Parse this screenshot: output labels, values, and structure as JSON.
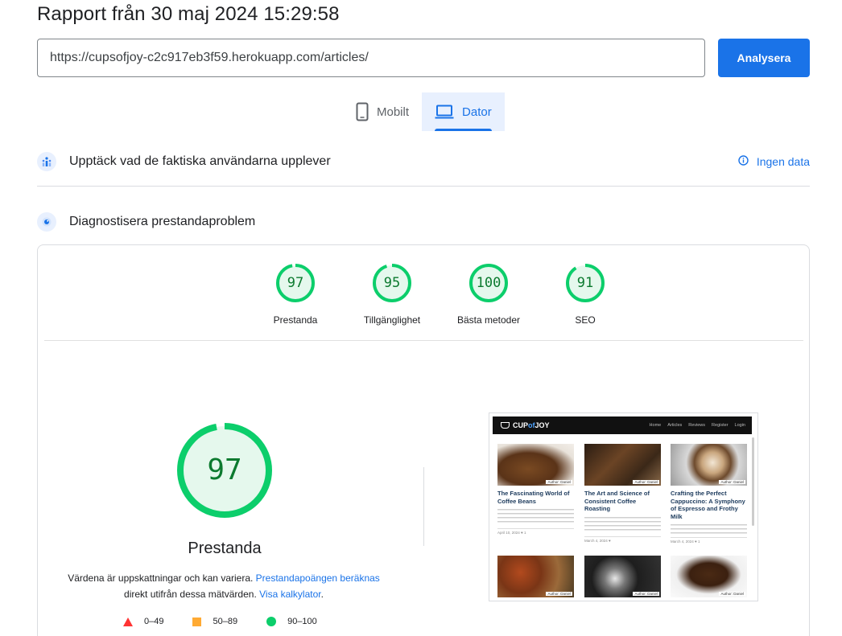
{
  "report": {
    "title": "Rapport från 30 maj 2024 15:29:58"
  },
  "url_input": {
    "value": "https://cupsofjoy-c2c917eb3f59.herokuapp.com/articles/"
  },
  "analyze_button": {
    "label": "Analysera"
  },
  "device_tabs": [
    {
      "label": "Mobilt",
      "icon": "smartphone-icon",
      "active": false
    },
    {
      "label": "Dator",
      "icon": "laptop-icon",
      "active": true
    }
  ],
  "field_data": {
    "title": "Upptäck vad de faktiska användarna upplever",
    "status": "Ingen data",
    "icon": "crux-icon"
  },
  "diagnose": {
    "title": "Diagnostisera prestandaproblem",
    "icon": "lighthouse-icon"
  },
  "scores": [
    {
      "value": 97,
      "label": "Prestanda"
    },
    {
      "value": 95,
      "label": "Tillgänglighet"
    },
    {
      "value": 100,
      "label": "Bästa metoder"
    },
    {
      "value": 91,
      "label": "SEO"
    }
  ],
  "performance": {
    "score": 97,
    "title": "Prestanda",
    "note_part1": "Värdena är uppskattningar och kan variera. ",
    "note_link1": "Prestandapoängen beräknas",
    "note_part2": " direkt utifrån dessa mätvärden. ",
    "note_link2": "Visa kalkylator",
    "note_part3": "."
  },
  "legend": [
    {
      "range": "0–49",
      "shape": "triangle",
      "color": "#ff3333"
    },
    {
      "range": "50–89",
      "shape": "square",
      "color": "#ffaa33"
    },
    {
      "range": "90–100",
      "shape": "circle",
      "color": "#0cce6b"
    }
  ],
  "colors": {
    "pass": "#0cce6b",
    "pass_text": "#0c7a2f",
    "pass_bg": "#e5f8ed",
    "accent": "#1a73e8"
  },
  "screenshot": {
    "logo_pre": "CUP",
    "logo_of": "of",
    "logo_post": "JOY",
    "nav_links": [
      "Home",
      "Articles",
      "Reviews",
      "Register",
      "Login"
    ],
    "articles": [
      {
        "title": "The Fascinating World of Coffee Beans",
        "author": "Author: Daniel",
        "date": "April 10, 2024 ♥ 1"
      },
      {
        "title": "The Art and Science of Consistent Coffee Roasting",
        "author": "Author: Daniel",
        "date": "March 4, 2024 ♥"
      },
      {
        "title": "Crafting the Perfect Cappuccino: A Symphony of Espresso and Frothy Milk",
        "author": "Author: Daniel",
        "date": "March 4, 2024 ♥ 1"
      },
      {
        "title": "",
        "author": "Author: Daniel",
        "date": ""
      },
      {
        "title": "",
        "author": "Author: Daniel",
        "date": ""
      },
      {
        "title": "",
        "author": "Author: Daniel",
        "date": ""
      }
    ]
  }
}
